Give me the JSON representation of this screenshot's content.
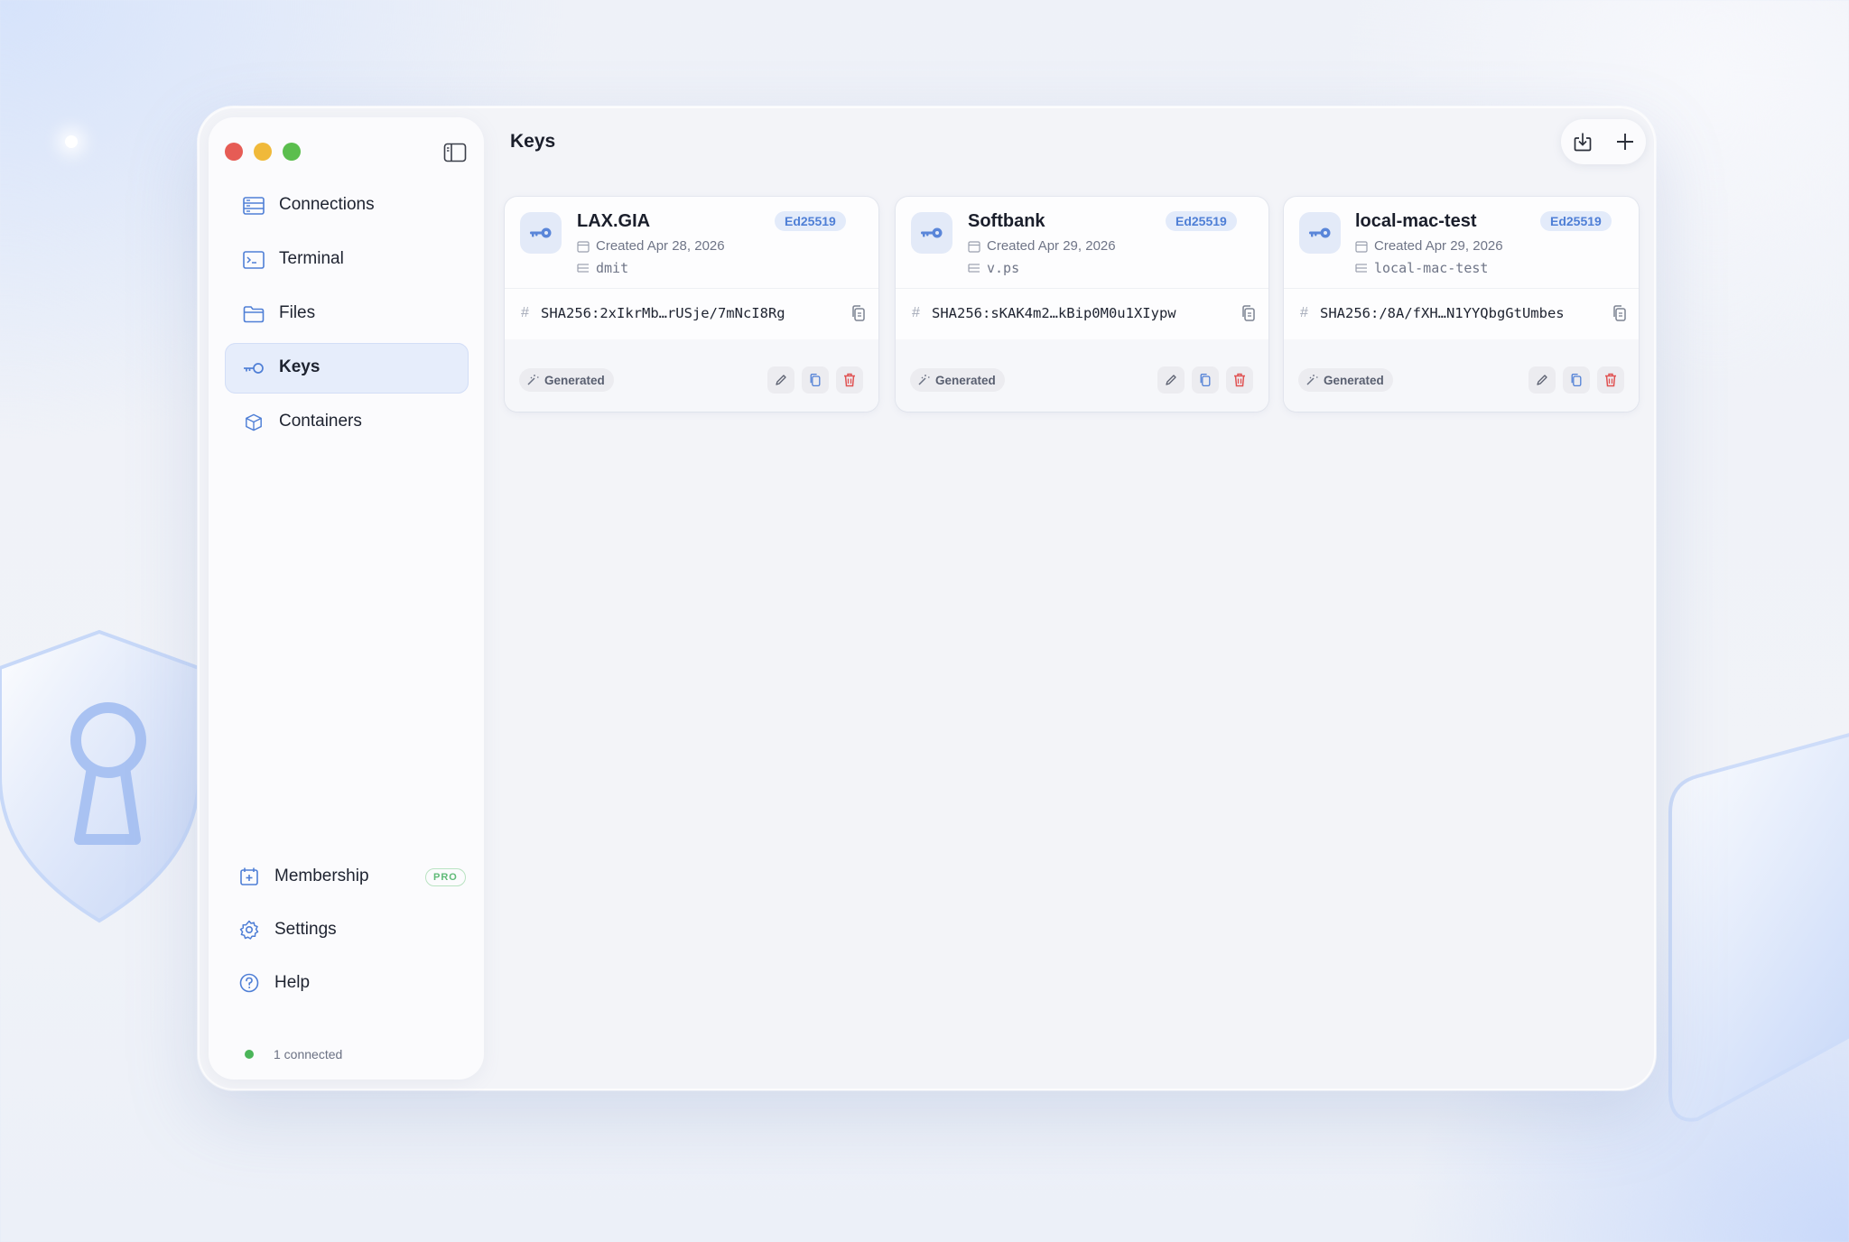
{
  "window": {
    "title": "Keys",
    "traffic_lights": [
      "close",
      "minimize",
      "zoom"
    ]
  },
  "sidebar": {
    "items": [
      {
        "label": "Connections",
        "icon": "server-icon",
        "active": false
      },
      {
        "label": "Terminal",
        "icon": "terminal-icon",
        "active": false
      },
      {
        "label": "Files",
        "icon": "folder-icon",
        "active": false
      },
      {
        "label": "Keys",
        "icon": "key-icon",
        "active": true
      },
      {
        "label": "Containers",
        "icon": "box-icon",
        "active": false
      }
    ],
    "bottom": {
      "membership": {
        "label": "Membership",
        "badge": "PRO"
      },
      "settings": {
        "label": "Settings"
      },
      "help": {
        "label": "Help"
      }
    },
    "status": {
      "text": "1 connected",
      "color": "#4bb559"
    }
  },
  "toolbar": {
    "import_icon": "import-icon",
    "add_icon": "plus-icon"
  },
  "keys": [
    {
      "name": "LAX.GIA",
      "algorithm": "Ed25519",
      "created": "Created Apr 28, 2026",
      "comment": "dmit",
      "fingerprint": "SHA256:2xIkrMb…rUSje/7mNcI8Rg",
      "source": "Generated"
    },
    {
      "name": "Softbank",
      "algorithm": "Ed25519",
      "created": "Created Apr 29, 2026",
      "comment": "v.ps",
      "fingerprint": "SHA256:sKAK4m2…kBip0M0u1XIypw",
      "source": "Generated"
    },
    {
      "name": "local-mac-test",
      "algorithm": "Ed25519",
      "created": "Created Apr 29, 2026",
      "comment": "local-mac-test",
      "fingerprint": "SHA256:/8A/fXH…N1YYQbgGtUmbes",
      "source": "Generated"
    }
  ],
  "colors": {
    "accent": "#4f7fd6",
    "delete": "#e05252",
    "pro_badge": "#5fba77"
  }
}
